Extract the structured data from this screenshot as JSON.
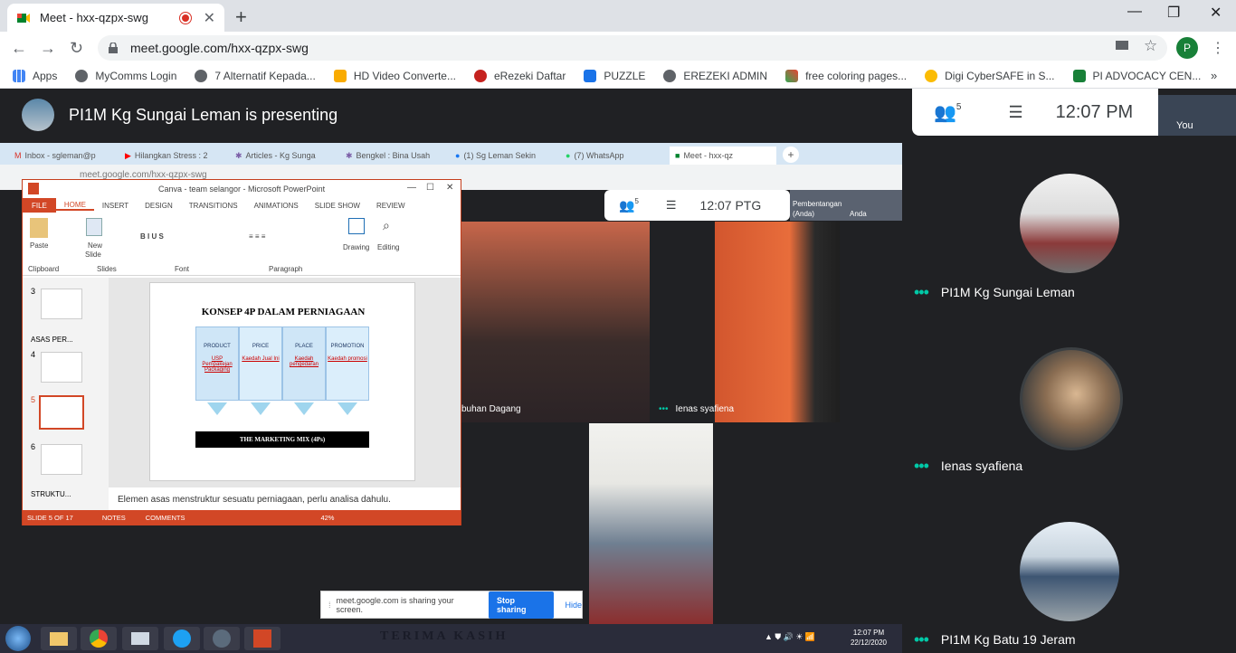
{
  "browser": {
    "tab_title": "Meet - hxx-qzpx-swg",
    "url": "meet.google.com/hxx-qzpx-swg",
    "profile_initial": "P",
    "bookmarks": [
      "Apps",
      "MyComms Login",
      "7 Alternatif Kepada...",
      "HD Video Converte...",
      "eRezeki Daftar",
      "PUZZLE",
      "EREZEKI ADMIN",
      "free coloring pages...",
      "Digi CyberSAFE in S...",
      "PI ADVOCACY CEN..."
    ]
  },
  "meet": {
    "presenter_text": "PI1M Kg Sungai Leman is presenting",
    "people_count": "5",
    "time": "12:07 PM",
    "self_label": "You"
  },
  "shared_screen": {
    "tabs": [
      "Inbox - sgleman@p",
      "Hilangkan Stress : 2",
      "Articles - Kg Sunga",
      "Bengkel : Bina Usah",
      "(1) Sg Leman Sekin",
      "(7) WhatsApp",
      "Meet - hxx-qz"
    ],
    "url": "meet.google.com/hxx-qzpx-swg",
    "inner_people_count": "5",
    "inner_time": "12:07 PTG",
    "inner_tile_label_1": "Pembentangan",
    "inner_tile_label_2": "(Anda)",
    "inner_tile_label_3": "Anda",
    "ppt": {
      "window_title": "Canva - team selangor - Microsoft PowerPoint",
      "tabs": [
        "FILE",
        "HOME",
        "INSERT",
        "DESIGN",
        "TRANSITIONS",
        "ANIMATIONS",
        "SLIDE SHOW",
        "REVIEW"
      ],
      "groups": [
        "Clipboard",
        "Slides",
        "Font",
        "Paragraph"
      ],
      "buttons": {
        "paste": "Paste",
        "new_slide": "New",
        "new_slide_2": "Slide",
        "drawing": "Drawing",
        "editing": "Editing"
      },
      "thumbs": {
        "n3": "3",
        "section1": "ASAS PER...",
        "n4": "4",
        "n5": "5",
        "n6": "6",
        "section2": "STRUKTU..."
      },
      "slide": {
        "title": "KONSEP 4P DALAM PERNIAGAAN",
        "cols": [
          {
            "head": "PRODUCT",
            "sub": "USP Pempakejan Packaging"
          },
          {
            "head": "PRICE",
            "sub": "Kaedah Jual Ini"
          },
          {
            "head": "PLACE",
            "sub": "Kaedah pengedaran"
          },
          {
            "head": "PROMOTION",
            "sub": "Kaedah promosi"
          }
        ],
        "bar": "THE MARKETING MIX (4Ps)"
      },
      "notes": "Elemen asas menstruktur sesuatu perniagaan, perlu analisa dahulu.",
      "status": {
        "slide": "SLIDE 5 OF 17",
        "notes": "NOTES",
        "comments": "COMMENTS",
        "zoom": "42%"
      }
    },
    "video_labels": {
      "a": "buhan Dagang",
      "b": "Ienas syafiena"
    },
    "share_bar": {
      "text": "meet.google.com is sharing your screen.",
      "stop": "Stop sharing",
      "hide": "Hide"
    },
    "taskbar": {
      "time": "12:07 PM",
      "date": "22/12/2020",
      "banner": "TERIMA KASIH"
    }
  },
  "participants": [
    {
      "name": "PI1M Kg Sungai Leman"
    },
    {
      "name": "Ienas syafiena"
    },
    {
      "name": "PI1M Kg Batu 19 Jeram"
    }
  ],
  "colors": {
    "meet_accent": "#00c9a7",
    "ppt_accent": "#d24726",
    "share_blue": "#1a73e8"
  }
}
